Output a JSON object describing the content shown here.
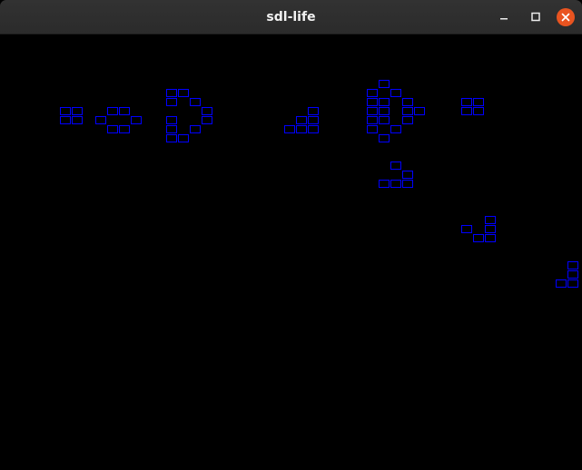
{
  "window": {
    "title": "sdl-life"
  },
  "controls": {
    "minimize_icon": "minimize-icon",
    "maximize_icon": "maximize-icon",
    "close_icon": "close-icon",
    "close_color": "#e95420"
  },
  "grid": {
    "cell_color": "#0000ff",
    "background": "#000000",
    "live_cells": [
      [
        5,
        8
      ],
      [
        6,
        8
      ],
      [
        5,
        9
      ],
      [
        6,
        9
      ],
      [
        9,
        8
      ],
      [
        10,
        8
      ],
      [
        8,
        9
      ],
      [
        11,
        9
      ],
      [
        9,
        10
      ],
      [
        10,
        10
      ],
      [
        14,
        6
      ],
      [
        15,
        6
      ],
      [
        14,
        7
      ],
      [
        16,
        7
      ],
      [
        17,
        8
      ],
      [
        14,
        9
      ],
      [
        17,
        9
      ],
      [
        16,
        10
      ],
      [
        14,
        10
      ],
      [
        14,
        11
      ],
      [
        15,
        11
      ],
      [
        26,
        8
      ],
      [
        25,
        9
      ],
      [
        26,
        9
      ],
      [
        24,
        10
      ],
      [
        25,
        10
      ],
      [
        26,
        10
      ],
      [
        32,
        5
      ],
      [
        31,
        6
      ],
      [
        33,
        6
      ],
      [
        31,
        7
      ],
      [
        32,
        7
      ],
      [
        34,
        7
      ],
      [
        31,
        8
      ],
      [
        32,
        8
      ],
      [
        34,
        8
      ],
      [
        35,
        8
      ],
      [
        31,
        9
      ],
      [
        32,
        9
      ],
      [
        34,
        9
      ],
      [
        31,
        10
      ],
      [
        33,
        10
      ],
      [
        32,
        11
      ],
      [
        39,
        7
      ],
      [
        40,
        7
      ],
      [
        39,
        8
      ],
      [
        40,
        8
      ],
      [
        33,
        14
      ],
      [
        34,
        15
      ],
      [
        32,
        16
      ],
      [
        33,
        16
      ],
      [
        34,
        16
      ],
      [
        41,
        20
      ],
      [
        39,
        21
      ],
      [
        41,
        21
      ],
      [
        40,
        22
      ],
      [
        41,
        22
      ],
      [
        48,
        25
      ],
      [
        48,
        26
      ],
      [
        47,
        27
      ],
      [
        48,
        27
      ]
    ]
  }
}
